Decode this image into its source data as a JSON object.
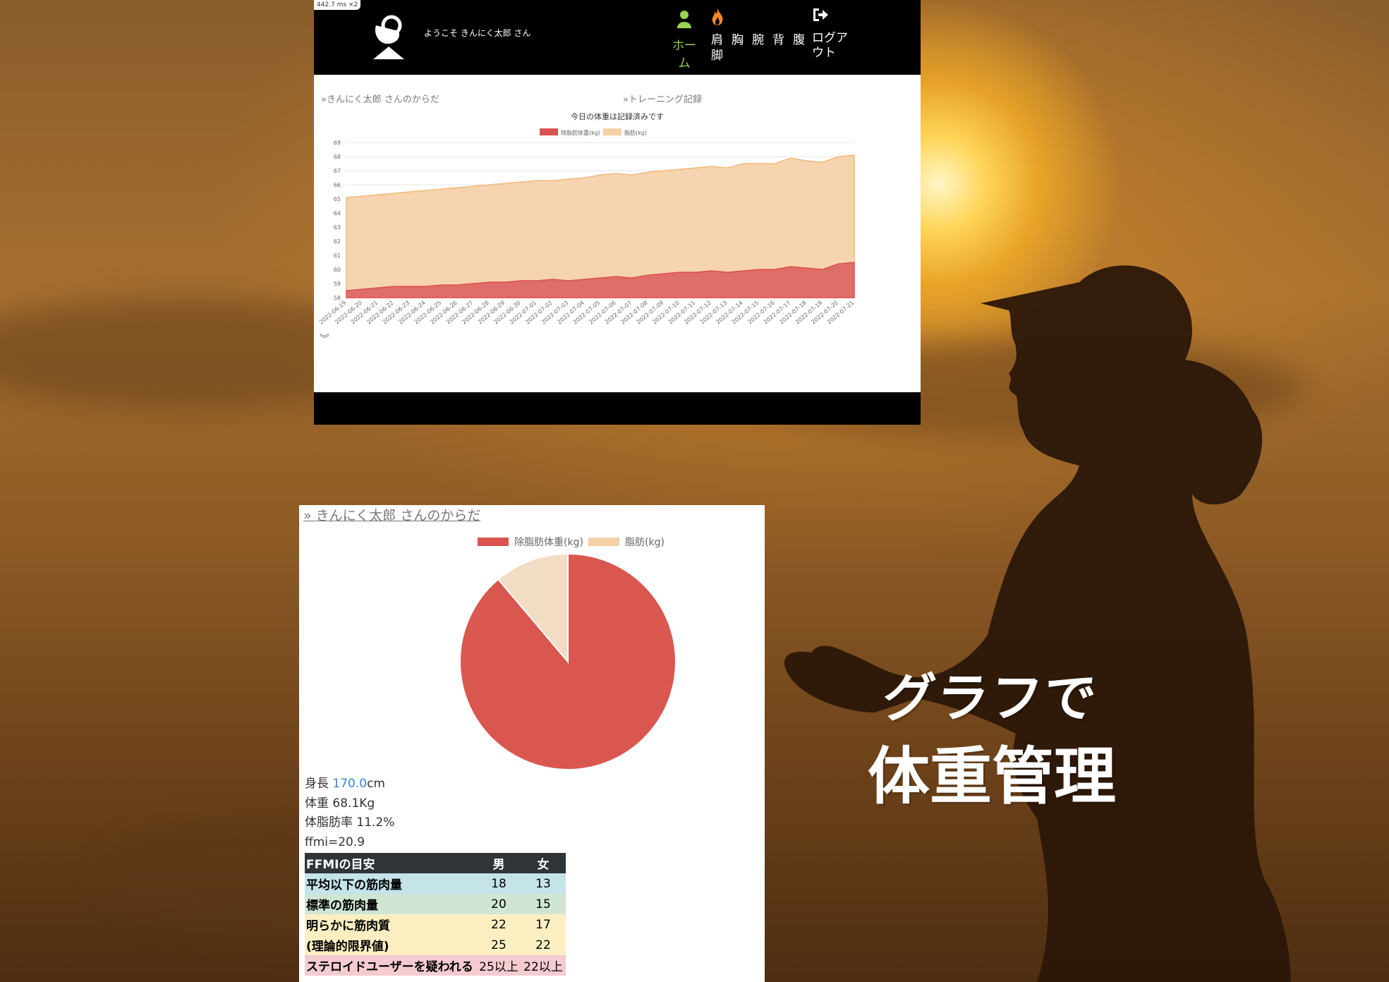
{
  "colors": {
    "lean": "#d9534f",
    "fat": "#f5cfa6",
    "home_green": "#9bd34f",
    "link_blue": "#3b82d6"
  },
  "overlay": {
    "line1": "グラフで",
    "line2": "体重管理"
  },
  "top_screenshot": {
    "perf_badge": "442.7 ms ×2",
    "welcome": "ようこそ きんにく太郎 さん",
    "nav": {
      "home": {
        "label": "ホーム",
        "icon": "person-icon"
      },
      "parts_col1": [
        "肩",
        "脚"
      ],
      "parts_single": [
        "胸",
        "腕",
        "背",
        "腹"
      ],
      "fire_icon": "fire-icon",
      "logout": {
        "label": "ログアウト",
        "icon": "logout-icon"
      }
    },
    "section_body": "きんにく太郎 さんのからだ",
    "section_training": "トレーニング記録",
    "chart_title": "今日の体重は記録済みです",
    "chart_data": {
      "type": "area",
      "stacked": true,
      "ylim": [
        58,
        69
      ],
      "yticks": [
        58,
        59,
        60,
        61,
        62,
        63,
        64,
        65,
        66,
        67,
        68,
        69
      ],
      "legend_position": "top",
      "categories": [
        "2022-06-19",
        "2022-06-20",
        "2022-06-21",
        "2022-06-22",
        "2022-06-23",
        "2022-06-24",
        "2022-06-25",
        "2022-06-26",
        "2022-06-27",
        "2022-06-28",
        "2022-06-29",
        "2022-06-30",
        "2022-07-01",
        "2022-07-02",
        "2022-07-03",
        "2022-07-04",
        "2022-07-05",
        "2022-07-06",
        "2022-07-07",
        "2022-07-08",
        "2022-07-09",
        "2022-07-10",
        "2022-07-11",
        "2022-07-12",
        "2022-07-13",
        "2022-07-14",
        "2022-07-15",
        "2022-07-16",
        "2022-07-17",
        "2022-07-18",
        "2022-07-19",
        "2022-07-20",
        "2022-07-21"
      ],
      "series": [
        {
          "name": "除脂肪体重(kg)",
          "values": [
            58.5,
            58.6,
            58.7,
            58.8,
            58.8,
            58.8,
            58.9,
            58.9,
            59.0,
            59.1,
            59.1,
            59.2,
            59.2,
            59.3,
            59.2,
            59.3,
            59.4,
            59.5,
            59.4,
            59.6,
            59.7,
            59.8,
            59.8,
            59.9,
            59.8,
            59.9,
            60.0,
            60.0,
            60.2,
            60.1,
            60.0,
            60.4,
            60.5
          ]
        },
        {
          "name": "脂肪(kg)",
          "values": [
            6.6,
            6.6,
            6.6,
            6.6,
            6.7,
            6.8,
            6.8,
            6.9,
            6.9,
            6.9,
            7.0,
            7.0,
            7.1,
            7.0,
            7.2,
            7.2,
            7.3,
            7.3,
            7.3,
            7.3,
            7.3,
            7.3,
            7.4,
            7.4,
            7.4,
            7.6,
            7.5,
            7.5,
            7.7,
            7.6,
            7.6,
            7.6,
            7.6
          ]
        }
      ]
    }
  },
  "bottom_screenshot": {
    "section_body": "きんにく太郎 さんのからだ",
    "chart_data": {
      "type": "pie",
      "legend_position": "top",
      "labels": [
        "除脂肪体重(kg)",
        "脂肪(kg)"
      ],
      "values": [
        60.5,
        7.6
      ]
    },
    "stats": {
      "height_label": "身長 ",
      "height_value": "170.0",
      "height_unit": "cm",
      "weight": "体重 68.1Kg",
      "bodyfat": "体脂肪率 11.2%",
      "ffmi": "ffmi=20.9"
    },
    "ffmi_table": {
      "headers": [
        "FFMIの目安",
        "男",
        "女"
      ],
      "rows": [
        [
          "平均以下の筋肉量",
          "18",
          "13"
        ],
        [
          "標準の筋肉量",
          "20",
          "15"
        ],
        [
          "明らかに筋肉質",
          "22",
          "17"
        ],
        [
          "(理論的限界値)",
          "25",
          "22"
        ],
        [
          "ステロイドユーザーを疑われる",
          "25以上",
          "22以上"
        ]
      ]
    }
  }
}
